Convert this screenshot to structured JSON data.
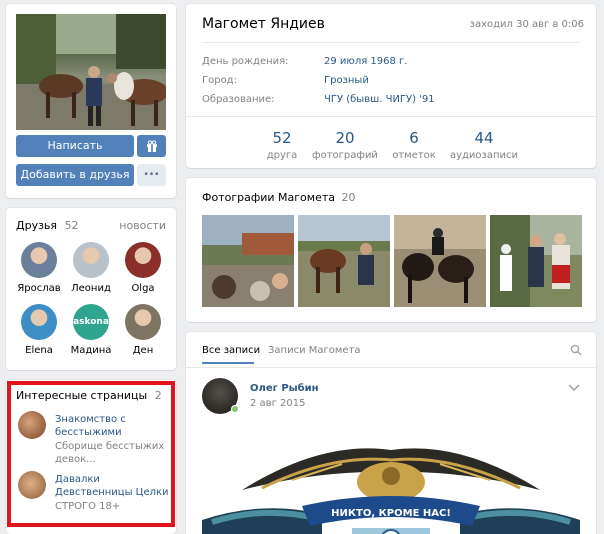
{
  "profile": {
    "name": "Магомет Яндиев",
    "last_seen": "заходил 30 авг в 0:06",
    "info": [
      {
        "label": "День рождения:",
        "value": "29 июля 1968 г."
      },
      {
        "label": "Город:",
        "value": "Грозный"
      },
      {
        "label": "Образование:",
        "value": "ЧГУ (бывш. ЧИГУ) '91"
      }
    ],
    "counters": [
      {
        "number": "52",
        "label": "друга"
      },
      {
        "number": "20",
        "label": "фотографий"
      },
      {
        "number": "6",
        "label": "отметок"
      },
      {
        "number": "44",
        "label": "аудиозаписи"
      }
    ]
  },
  "actions": {
    "message_label": "Написать сообщение",
    "gift_icon": "gift-icon",
    "add_friend_label": "Добавить в друзья",
    "more_label": "•••"
  },
  "friends": {
    "title": "Друзья",
    "count": "52",
    "news_link": "новости",
    "items": [
      {
        "name": "Ярослав",
        "color": "#6a7f9a"
      },
      {
        "name": "Леонид",
        "color": "#b9c1c9"
      },
      {
        "name": "Olga",
        "color": "#8a2f2a"
      },
      {
        "name": "Elena",
        "color": "#3d8ec6"
      },
      {
        "name": "Мадина",
        "color": "#2fa58f",
        "badge": "askona"
      },
      {
        "name": "Ден",
        "color": "#7e7462"
      }
    ]
  },
  "pages": {
    "title": "Интересные страницы",
    "count": "2",
    "items": [
      {
        "title": "Знакомство с бесстыжими",
        "desc": "Сборище бесстыжих девок...",
        "color": "#a0643e"
      },
      {
        "title": "Давалки Девственницы Целки",
        "desc": "СТРОГО 18+",
        "color": "#c08a5a"
      }
    ]
  },
  "photos": {
    "title": "Фотографии Магомета",
    "count": "20",
    "thumb_colors": [
      "#6d7b54",
      "#8c7b5b",
      "#3c3a38",
      "#7e8a5e"
    ]
  },
  "wall": {
    "tabs": [
      "Все записи",
      "Записи Магомета"
    ],
    "post": {
      "author": "Олег Рыбин",
      "date": "2 авг 2015",
      "emblem_text": "НИКТО, КРОМЕ НАС!"
    }
  },
  "colors": {
    "accent": "#5181b8",
    "link": "#2a5885",
    "highlight_border": "#e0141a"
  }
}
